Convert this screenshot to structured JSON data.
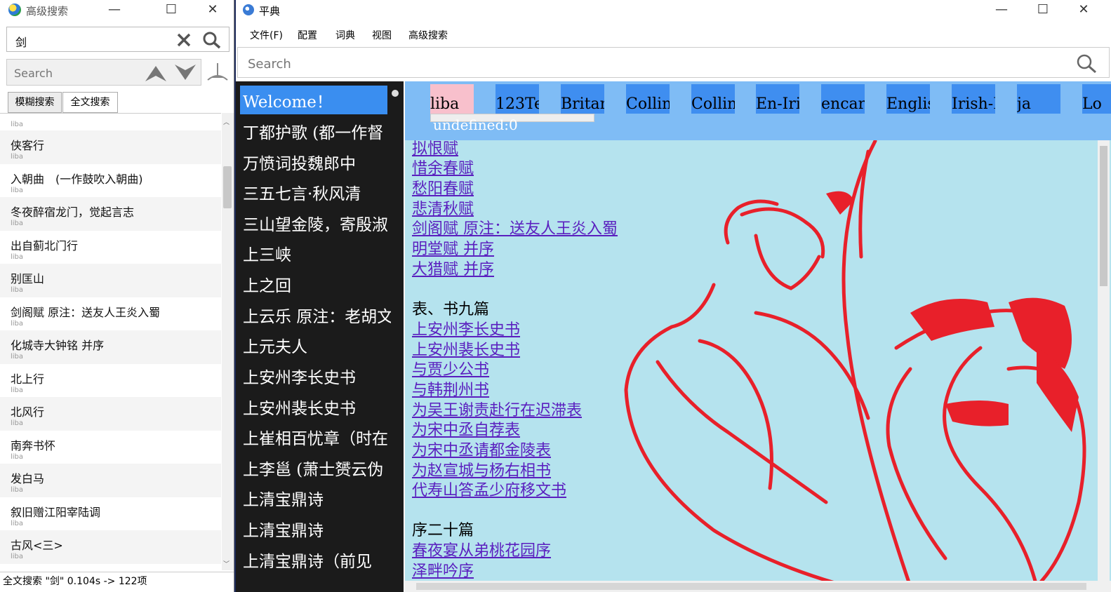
{
  "left_window": {
    "title": "高级搜索",
    "search_value": "剑",
    "filter_placeholder": "Search",
    "tabs": [
      "模糊搜索",
      "全文搜索"
    ],
    "results": [
      {
        "title": "侠客行",
        "source": "liba"
      },
      {
        "title": "入朝曲　(一作鼓吹入朝曲)",
        "source": "liba"
      },
      {
        "title": "冬夜醉宿龙门，觉起言志",
        "source": "liba"
      },
      {
        "title": "出自蓟北门行",
        "source": "liba"
      },
      {
        "title": "别匡山",
        "source": "liba"
      },
      {
        "title": "剑阁赋 原注：送友人王炎入蜀",
        "source": "liba"
      },
      {
        "title": "化城寺大钟铭 并序",
        "source": "liba"
      },
      {
        "title": "北上行",
        "source": "liba"
      },
      {
        "title": "北风行",
        "source": "liba"
      },
      {
        "title": "南奔书怀",
        "source": "liba"
      },
      {
        "title": "发白马",
        "source": "liba"
      },
      {
        "title": "叙旧赠江阳宰陆调",
        "source": "liba"
      },
      {
        "title": "古风<三>",
        "source": "liba"
      }
    ],
    "status": "全文搜索 \"剑\" 0.104s -> 122项"
  },
  "main_window": {
    "title": "平典",
    "menu": [
      "文件(F)",
      "配置",
      "词典",
      "视图",
      "高级搜索"
    ],
    "search_placeholder": "Search",
    "word_list": [
      "Welcome！",
      "丁都护歌 (都一作督",
      "万愤词投魏郎中",
      "三五七言·秋风清",
      "三山望金陵，寄殷淑",
      "上三峡",
      "上之回",
      "上云乐 原注：老胡文",
      "上元夫人",
      "上安州李长史书",
      "上安州裴长史书",
      "上崔相百忧章（时在",
      "上李邕 (萧士赟云伪",
      "上清宝鼎诗",
      "上清宝鼎诗",
      "上清宝鼎诗（前见"
    ],
    "dict_tabs": [
      "liba",
      "123Te",
      "Britan",
      "Collin",
      "Collin",
      "En-Iris",
      "encart",
      "Englis",
      "Irish-E",
      "ja",
      "Lo"
    ],
    "undefined_text": "undefined:0",
    "content_links_a": [
      "拟恨赋",
      "惜余春赋",
      "愁阳春赋",
      "悲清秋赋",
      "剑阁赋 原注：送友人王炎入蜀",
      "明堂赋 并序",
      "大猎赋 并序"
    ],
    "section_b": "表、书九篇",
    "content_links_b": [
      "上安州李长史书",
      "上安州裴长史书",
      "与贾少公书",
      "与韩荆州书",
      "为吴王谢责赴行在迟滞表",
      "为宋中丞自荐表",
      "为宋中丞请都金陵表",
      "为赵宣城与杨右相书",
      "代寿山答孟少府移文书"
    ],
    "section_c": "序二十篇",
    "content_links_c": [
      "春夜宴从弟桃花园序",
      "泽畔吟序"
    ]
  }
}
